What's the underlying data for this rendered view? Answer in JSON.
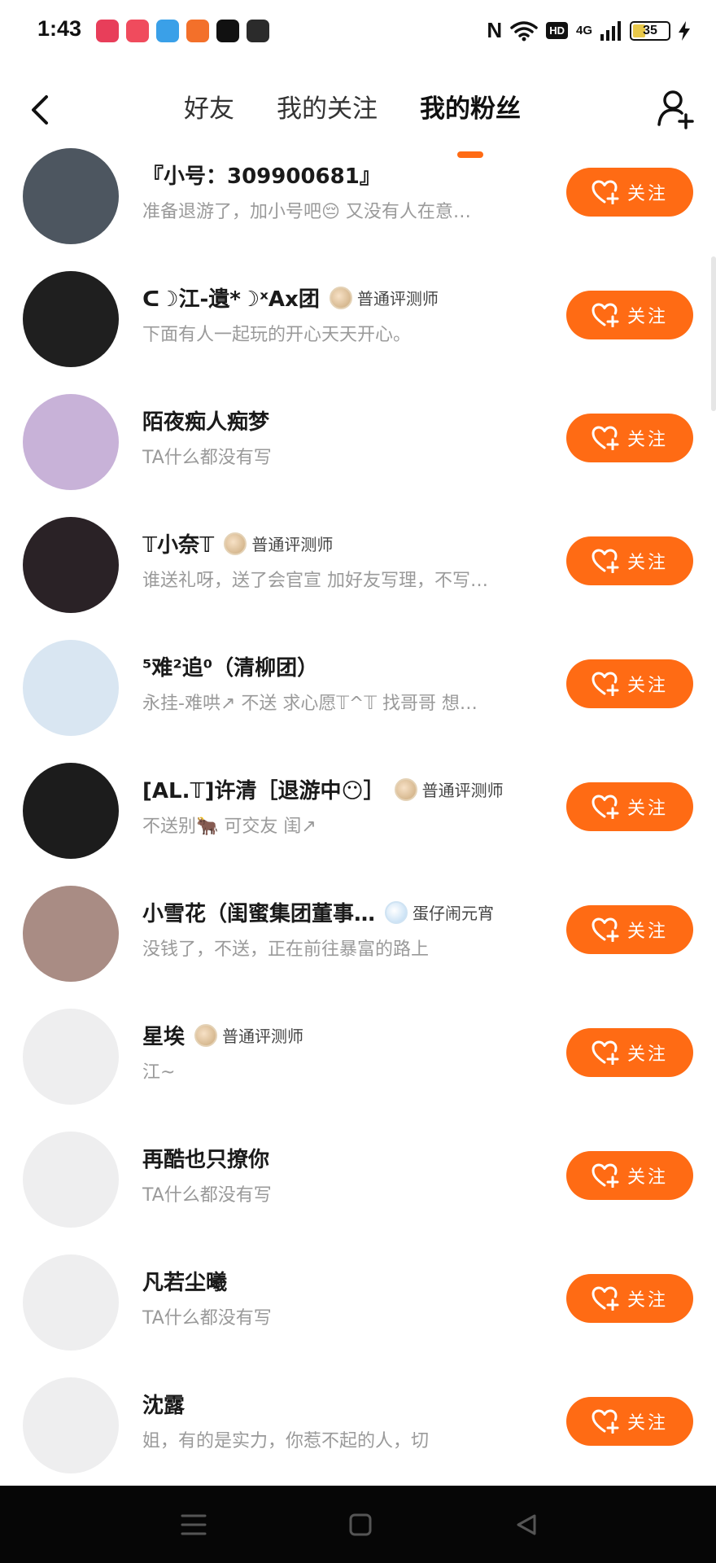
{
  "status_bar": {
    "time": "1:43",
    "nfc": "N",
    "hd": "HD",
    "signal": "4G",
    "battery": "35",
    "battery_level": 0.35,
    "app_icons": [
      {
        "name": "video-app-icon",
        "color": "#e83e5a"
      },
      {
        "name": "game-app-icon",
        "color": "#f04b5d"
      },
      {
        "name": "browser-app-icon",
        "color": "#3aa0e8"
      },
      {
        "name": "shop-app-icon",
        "color": "#f3702a"
      },
      {
        "name": "tiktok-app-icon",
        "color": "#111111"
      },
      {
        "name": "green-app-icon",
        "color": "#2b2b2b"
      }
    ]
  },
  "header": {
    "tabs": [
      {
        "label": "好友",
        "active": false
      },
      {
        "label": "我的关注",
        "active": false
      },
      {
        "label": "我的粉丝",
        "active": true
      }
    ]
  },
  "follow_label": "关注",
  "accent_color": "#ff6b14",
  "fans": [
    {
      "name": "『小号：309900681』",
      "desc": "准备退游了，加小号吧😔 又没有人在意…",
      "badge": "",
      "avatar_color": "#4d5660"
    },
    {
      "name": "ᑕ☽江-遺*☽ˣAx团",
      "desc": "下面有人一起玩的开心天天开心。",
      "badge": "普通评测师",
      "avatar_color": "#1f1f1f"
    },
    {
      "name": "陌夜痴人痴梦",
      "desc": "TA什么都没有写",
      "badge": "",
      "avatar_color": "#c8b2d8"
    },
    {
      "name": "𝕋小奈𝕋",
      "desc": "谁送礼呀，送了会官宣 加好友写理，不写…",
      "badge": "普通评测师",
      "avatar_color": "#2a2226"
    },
    {
      "name": "⁵难²追⁰（清柳团）",
      "desc": "永挂-难哄↗ 不送 求心愿𝕋^𝕋 找哥哥 想…",
      "badge": "",
      "avatar_color": "#d9e6f2"
    },
    {
      "name": "[AL.𝕋]许清［退游中😶］",
      "desc": "不送别🐂 可交友 闺↗",
      "badge": "普通评测师",
      "avatar_color": "#1c1c1c"
    },
    {
      "name": "小雪花（闺蜜集团董事…",
      "desc": "没钱了，不送，正在前往暴富的路上",
      "badge": "蛋仔闹元宵",
      "avatar_color": "#a98c84"
    },
    {
      "name": "星埃",
      "desc": "江~",
      "badge": "普通评测师",
      "avatar_color": "#eeeeef"
    },
    {
      "name": "再酷也只撩你",
      "desc": "TA什么都没有写",
      "badge": "",
      "avatar_color": "#eeeeef"
    },
    {
      "name": "凡若尘曦",
      "desc": "TA什么都没有写",
      "badge": "",
      "avatar_color": "#eeeeef"
    },
    {
      "name": "沈露",
      "desc": "姐，有的是实力，你惹不起的人，切",
      "badge": "",
      "avatar_color": "#eeeeef"
    }
  ]
}
